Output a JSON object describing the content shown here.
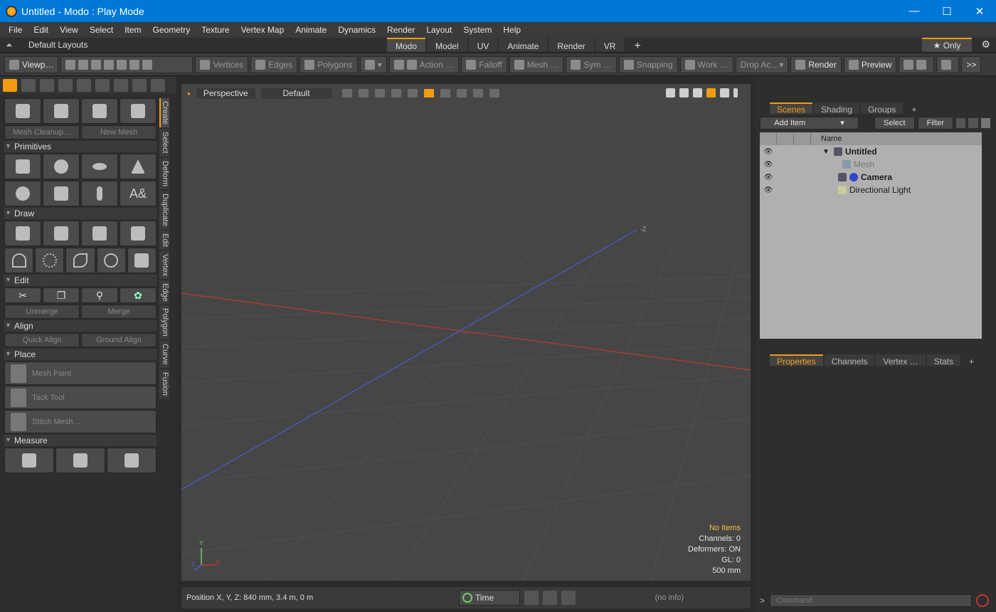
{
  "titlebar": {
    "title": "Untitled - Modo : Play Mode"
  },
  "menu": [
    "File",
    "Edit",
    "View",
    "Select",
    "Item",
    "Geometry",
    "Texture",
    "Vertex Map",
    "Animate",
    "Dynamics",
    "Render",
    "Layout",
    "System",
    "Help"
  ],
  "layoutbar": {
    "layout_name": "Default Layouts",
    "tabs": [
      "Modo",
      "Model",
      "UV",
      "Animate",
      "Render",
      "VR"
    ],
    "add_tab": "+",
    "only_label": "★  Only"
  },
  "toolbar": {
    "viewport": "Viewp…",
    "vertices": "Vertices",
    "edges": "Edges",
    "polygons": "Polygons",
    "action": "Action …",
    "falloff": "Falloff",
    "mesh": "Mesh  …",
    "sym": "Sym …",
    "snapping": "Snapping",
    "work": "Work …",
    "drop_action": "Drop Ac…",
    "render": "Render",
    "preview": "Preview",
    "more": ">>"
  },
  "left": {
    "mesh_cleanup": "Mesh Cleanup…",
    "new_mesh": "New Mesh",
    "sections": {
      "primitives": "Primitives",
      "draw": "Draw",
      "edit": "Edit",
      "align": "Align",
      "place": "Place",
      "measure": "Measure"
    },
    "unmerge": "Unmerge",
    "merge": "Merge",
    "quick_align": "Quick Align",
    "ground_align": "Ground Align",
    "mesh_paint": "Mesh Paint",
    "tack_tool": "Tack Tool",
    "stitch_mesh": "Stitch Mesh…",
    "vtabs": [
      "Create",
      "Select",
      "Deform",
      "Duplicate",
      "Edit",
      "Vertex",
      "Edge",
      "Polygon",
      "Curve",
      "Fusion"
    ]
  },
  "viewport": {
    "view_mode": "Perspective",
    "shading": "Default",
    "axis_z": "-Z",
    "gizmo_y": "Y",
    "gizmo_z": "Z",
    "gizmo_x": "X",
    "info": {
      "no_items": "No Items",
      "channels": "Channels: 0",
      "deformers": "Deformers: ON",
      "gl": "GL: 0",
      "scale": "500 mm"
    }
  },
  "status": {
    "position": "Position X, Y, Z:   840 mm, 3.4 m, 0 m",
    "time": "Time",
    "noinfo": "(no info)"
  },
  "right": {
    "scene_tabs": [
      "Scenes",
      "Shading",
      "Groups"
    ],
    "add_item": "Add Item",
    "select": "Select",
    "filter": "Filter",
    "name_col": "Name",
    "items": [
      {
        "name": "Untitled",
        "bold": true
      },
      {
        "name": "Mesh",
        "dim": true
      },
      {
        "name": "Camera",
        "bold": true
      },
      {
        "name": "Directional Light"
      }
    ],
    "prop_tabs": [
      "Properties",
      "Channels",
      "Vertex  …",
      "Stats"
    ],
    "command_placeholder": "Command",
    "cmd_arrow": ">"
  },
  "colors": {
    "accent": "#f39c12",
    "titlebar": "#0078d7"
  }
}
